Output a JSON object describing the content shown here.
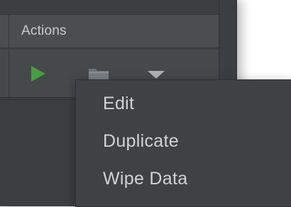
{
  "table": {
    "actions_header": "Actions",
    "row_icons": [
      "play-icon",
      "folder-icon",
      "dropdown-icon"
    ]
  },
  "context_menu": {
    "items": [
      {
        "label": "Edit"
      },
      {
        "label": "Duplicate"
      },
      {
        "label": "Wipe Data"
      }
    ]
  },
  "colors": {
    "background": "#3c3f41",
    "header": "#4b4e50",
    "row": "#45494a",
    "menu": "#3f4244",
    "play_green": "#4a9c46",
    "text": "#d0d2d4"
  }
}
